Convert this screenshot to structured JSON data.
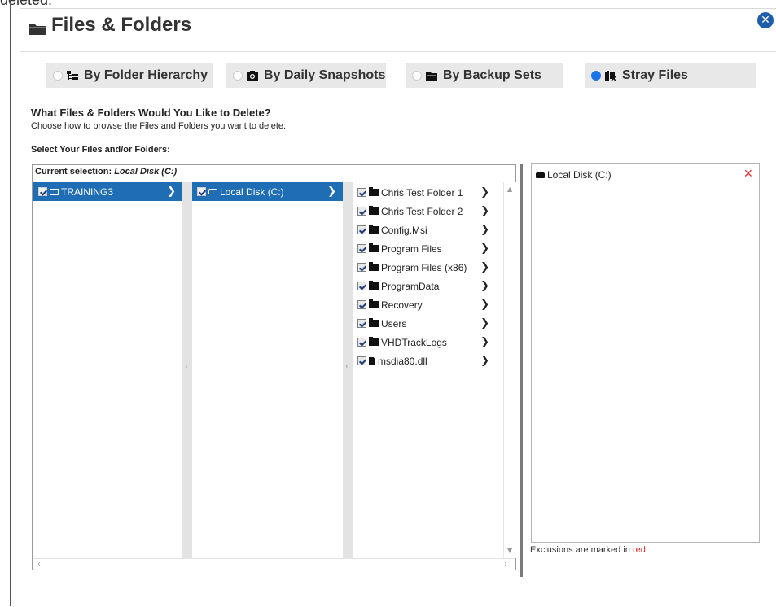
{
  "top_partial_text": "deleted.",
  "title": "Files & Folders",
  "tabs": [
    {
      "label": "By Folder Hierarchy",
      "selected": false,
      "icon": "folder-tree-icon"
    },
    {
      "label": "By Daily Snapshots",
      "selected": false,
      "icon": "camera-icon"
    },
    {
      "label": "By Backup Sets",
      "selected": false,
      "icon": "folder-open-icon"
    },
    {
      "label": "Stray Files",
      "selected": true,
      "icon": "stray-files-icon"
    }
  ],
  "question": "What Files & Folders Would You Like to Delete?",
  "question_sub": "Choose how to browse the Files and Folders you want to delete:",
  "select_label": "Select Your Files and/or Folders:",
  "browser": {
    "current_label": "Current selection:",
    "current_value": "Local Disk (C:)",
    "column1": [
      {
        "label": "TRAINING3",
        "icon": "computer-icon",
        "checked": true,
        "selected": true
      }
    ],
    "column2": [
      {
        "label": "Local Disk (C:)",
        "icon": "disk-icon",
        "checked": true,
        "selected": true
      }
    ],
    "column3": [
      {
        "label": "Chris Test Folder 1",
        "icon": "folder-icon",
        "checked": true
      },
      {
        "label": "Chris Test Folder 2",
        "icon": "folder-icon",
        "checked": true
      },
      {
        "label": "Config.Msi",
        "icon": "folder-icon",
        "checked": true
      },
      {
        "label": "Program Files",
        "icon": "folder-icon",
        "checked": true
      },
      {
        "label": "Program Files (x86)",
        "icon": "folder-icon",
        "checked": true
      },
      {
        "label": "ProgramData",
        "icon": "folder-icon",
        "checked": true
      },
      {
        "label": "Recovery",
        "icon": "folder-icon",
        "checked": true
      },
      {
        "label": "Users",
        "icon": "folder-icon",
        "checked": true
      },
      {
        "label": "VHDTrackLogs",
        "icon": "folder-icon",
        "checked": true
      },
      {
        "label": "msdia80.dll",
        "icon": "file-icon",
        "checked": true
      }
    ]
  },
  "selection_panel": {
    "items": [
      {
        "label": "Local Disk (C:)",
        "icon": "disk-icon"
      }
    ]
  },
  "exclusion_note": {
    "prefix": "Exclusions are marked in ",
    "red_word": "red",
    "suffix": "."
  },
  "colors": {
    "accent": "#1f6eb5",
    "radio_on": "#1a73e8",
    "exclusion": "#e03030",
    "close": "#1f5da8"
  }
}
